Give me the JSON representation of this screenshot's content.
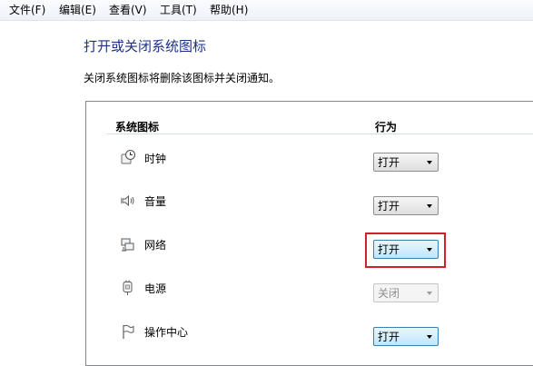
{
  "menu": {
    "items": [
      {
        "label": "文件(F)"
      },
      {
        "label": "编辑(E)"
      },
      {
        "label": "查看(V)"
      },
      {
        "label": "工具(T)"
      },
      {
        "label": "帮助(H)"
      }
    ]
  },
  "page": {
    "title": "打开或关闭系统图标",
    "description": "关闭系统图标将删除该图标并关闭通知。"
  },
  "table": {
    "col_icon": "系统图标",
    "col_behavior": "行为",
    "rows": [
      {
        "label": "时钟",
        "icon": "clock-icon",
        "behavior": "打开",
        "enabled": true
      },
      {
        "label": "音量",
        "icon": "volume-icon",
        "behavior": "打开",
        "enabled": true
      },
      {
        "label": "网络",
        "icon": "network-icon",
        "behavior": "打开",
        "enabled": true
      },
      {
        "label": "电源",
        "icon": "power-icon",
        "behavior": "关闭",
        "enabled": false
      },
      {
        "label": "操作中心",
        "icon": "action-center-flag-icon",
        "behavior": "打开",
        "enabled": true
      }
    ]
  },
  "colors": {
    "title": "#1e3287",
    "highlight_box": "#d0202a"
  }
}
